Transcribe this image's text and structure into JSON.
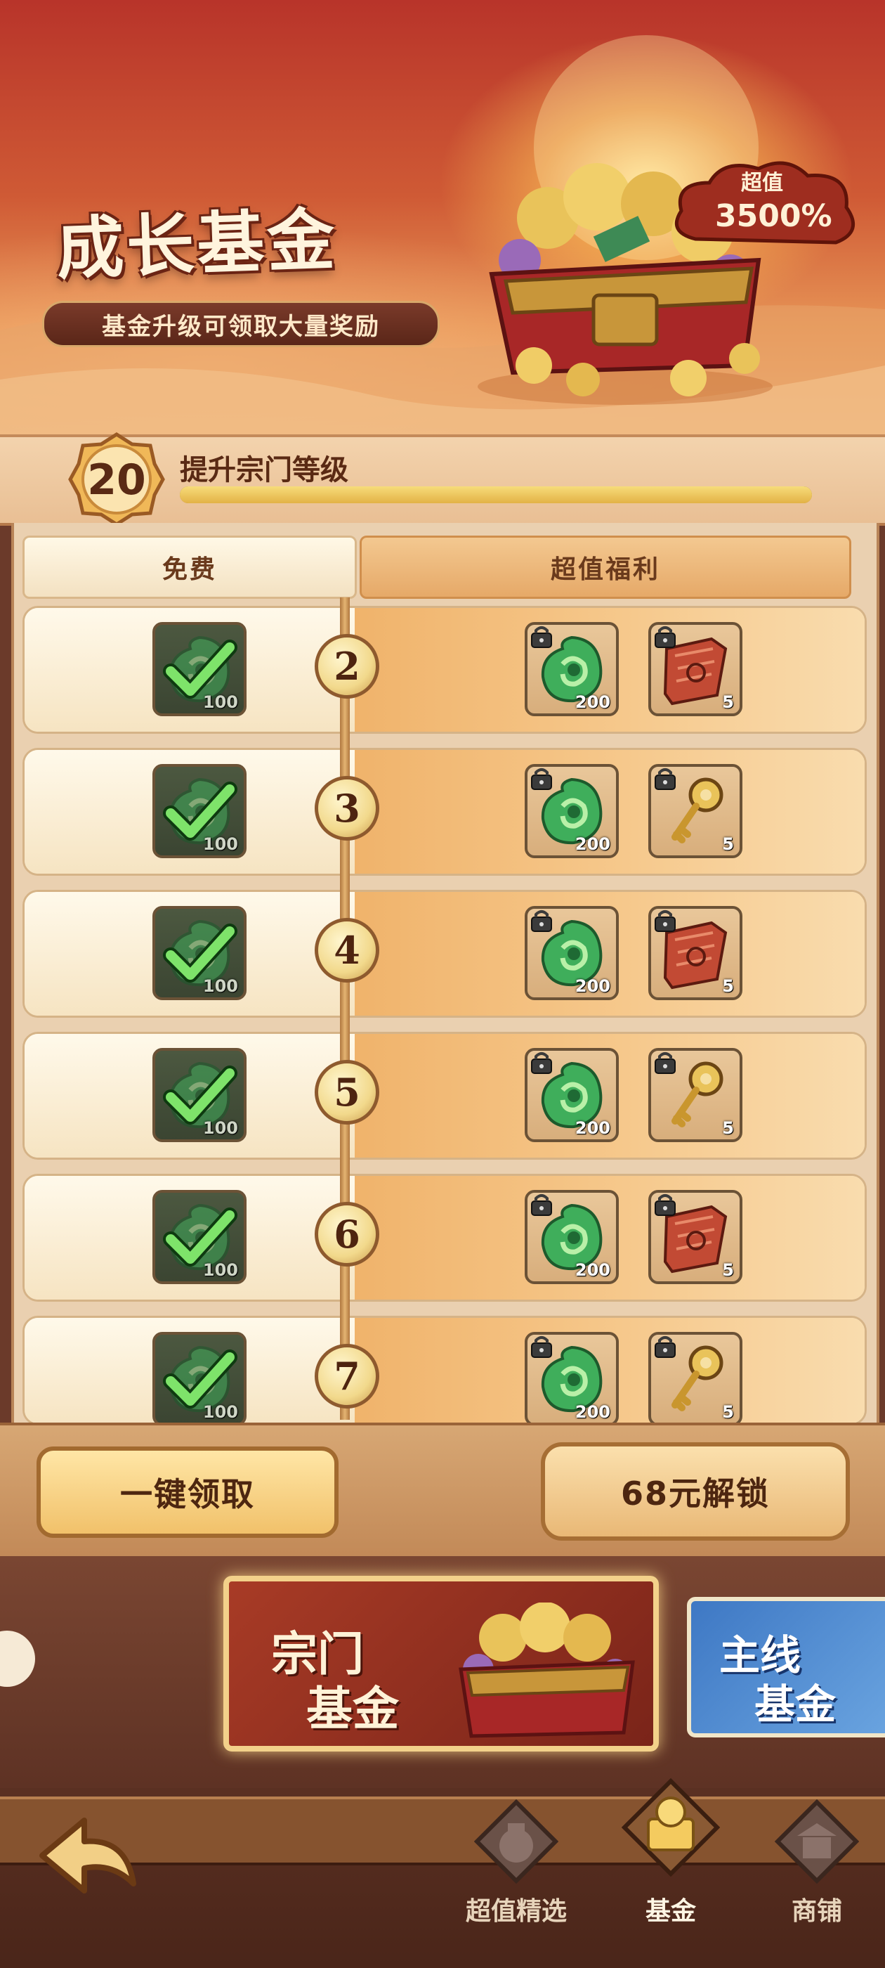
{
  "banner": {
    "title": "成长基金",
    "subtitle": "基金升级可领取大量奖励",
    "value_label": "超值",
    "value_percent": "3500%"
  },
  "level": {
    "number": "20",
    "label": "提升宗门等级",
    "progress": 1.0
  },
  "columns": {
    "free": "免费",
    "premium": "超值福利"
  },
  "rows": [
    {
      "level": "2",
      "free": {
        "icon": "jade-dragon-icon",
        "qty": "100",
        "claimed": true
      },
      "premium": [
        {
          "icon": "jade-dragon-icon",
          "qty": "200",
          "locked": true
        },
        {
          "icon": "red-scroll-icon",
          "qty": "5",
          "locked": true
        }
      ]
    },
    {
      "level": "3",
      "free": {
        "icon": "jade-dragon-icon",
        "qty": "100",
        "claimed": true
      },
      "premium": [
        {
          "icon": "jade-dragon-icon",
          "qty": "200",
          "locked": true
        },
        {
          "icon": "golden-key-icon",
          "qty": "5",
          "locked": true
        }
      ]
    },
    {
      "level": "4",
      "free": {
        "icon": "jade-dragon-icon",
        "qty": "100",
        "claimed": true
      },
      "premium": [
        {
          "icon": "jade-dragon-icon",
          "qty": "200",
          "locked": true
        },
        {
          "icon": "red-scroll-icon",
          "qty": "5",
          "locked": true
        }
      ]
    },
    {
      "level": "5",
      "free": {
        "icon": "jade-dragon-icon",
        "qty": "100",
        "claimed": true
      },
      "premium": [
        {
          "icon": "jade-dragon-icon",
          "qty": "200",
          "locked": true
        },
        {
          "icon": "golden-key-icon",
          "qty": "5",
          "locked": true
        }
      ]
    },
    {
      "level": "6",
      "free": {
        "icon": "jade-dragon-icon",
        "qty": "100",
        "claimed": true
      },
      "premium": [
        {
          "icon": "jade-dragon-icon",
          "qty": "200",
          "locked": true
        },
        {
          "icon": "red-scroll-icon",
          "qty": "5",
          "locked": true
        }
      ]
    },
    {
      "level": "7",
      "free": {
        "icon": "jade-dragon-icon",
        "qty": "100",
        "claimed": true
      },
      "premium": [
        {
          "icon": "jade-dragon-icon",
          "qty": "200",
          "locked": true
        },
        {
          "icon": "golden-key-icon",
          "qty": "5",
          "locked": true
        }
      ]
    }
  ],
  "buttons": {
    "claim_all": "一键领取",
    "unlock": "68元解锁"
  },
  "fund_tabs": [
    {
      "line1": "宗门",
      "line2": "基金",
      "active": true
    },
    {
      "line1": "主线",
      "line2": "基金",
      "active": false
    }
  ],
  "nav": [
    {
      "label": "超值精选",
      "icon": "treasure-bag-icon",
      "active": false
    },
    {
      "label": "基金",
      "icon": "gold-ingot-icon",
      "active": true
    },
    {
      "label": "商铺",
      "icon": "shop-pagoda-icon",
      "active": false
    }
  ]
}
